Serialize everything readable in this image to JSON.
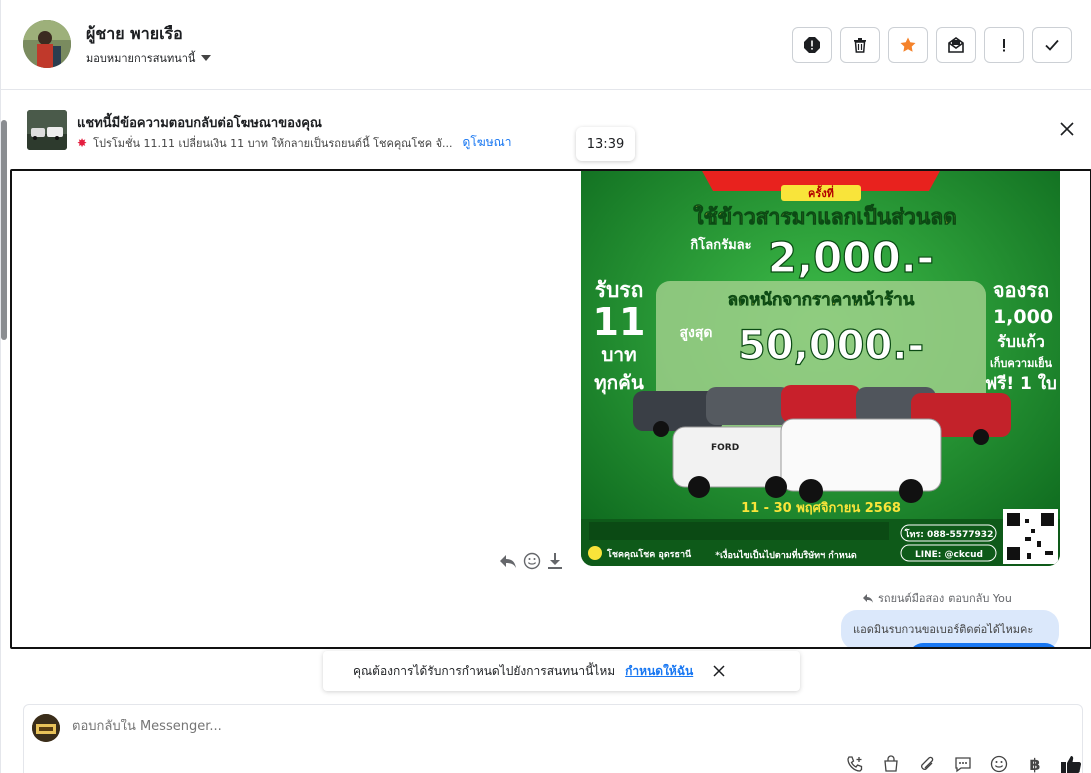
{
  "header": {
    "contact_name": "ผู้ชาย พายเรือ",
    "assign_label": "มอบหมายการสนทนานี้"
  },
  "actions": [
    {
      "name": "report-icon"
    },
    {
      "name": "trash-icon"
    },
    {
      "name": "star-icon"
    },
    {
      "name": "mark-unread-icon"
    },
    {
      "name": "exclamation-icon"
    },
    {
      "name": "check-icon"
    }
  ],
  "ad": {
    "title": "แชทนี้มีข้อความตอบกลับต่อโฆษณาของคุณ",
    "description": "โปรโมชั่น 11.11 เปลี่ยนเงิน 11 บาท ให้กลายเป็นรถยนต์นี้ โชคคุณโชค จั...",
    "link": "ดูโฆษณา"
  },
  "timestamp": "13:39",
  "promo_image": {
    "time_label": "ครั้งที่",
    "headline": "ใช้ข้าวสารมาแลกเป็นส่วนลด",
    "per_kg": "กิโลกรัมละ",
    "per_kg_value": "2,000.-",
    "left_1": "รับรถ",
    "left_2": "11",
    "left_3": "บาท",
    "left_4": "ทุกคัน",
    "center_1": "ลดหนักจากราคาหน้าร้าน",
    "center_2": "สูงสุด",
    "center_value": "50,000.-",
    "right_1": "จองรถ",
    "right_2": "1,000",
    "right_3": "รับแก้ว",
    "right_4": "เก็บความเย็น",
    "right_5": "ฟรี! 1 ใบ",
    "dates": "11 - 30 พฤศจิกายน 2568",
    "phone": "โทร: 088-5577932",
    "line": "LINE: @ckcud",
    "brand": "โชคคุณโชค อุดรธานี",
    "note": "*เงื่อนไขเป็นไปตามที่บริษัทฯ กำหนด",
    "ford_label": "FORD"
  },
  "reply_meta": {
    "sender": "รถยนต์มือสอง",
    "action": "ตอบกลับ You"
  },
  "bubble_text": "แอดมินรบกวนขอเบอร์ติดต่อได้ไหมคะ",
  "assign_prompt": {
    "question": "คุณต้องการได้รับการกำหนดไปยังการสนทนานี้ไหม",
    "link": "กำหนดให้ฉัน"
  },
  "composer": {
    "placeholder": "ตอบกลับใน Messenger..."
  },
  "colors": {
    "accent": "#1877f2",
    "star": "#f5822a",
    "promo_green": "#1f8a2c",
    "promo_yellow": "#f9e43a"
  }
}
